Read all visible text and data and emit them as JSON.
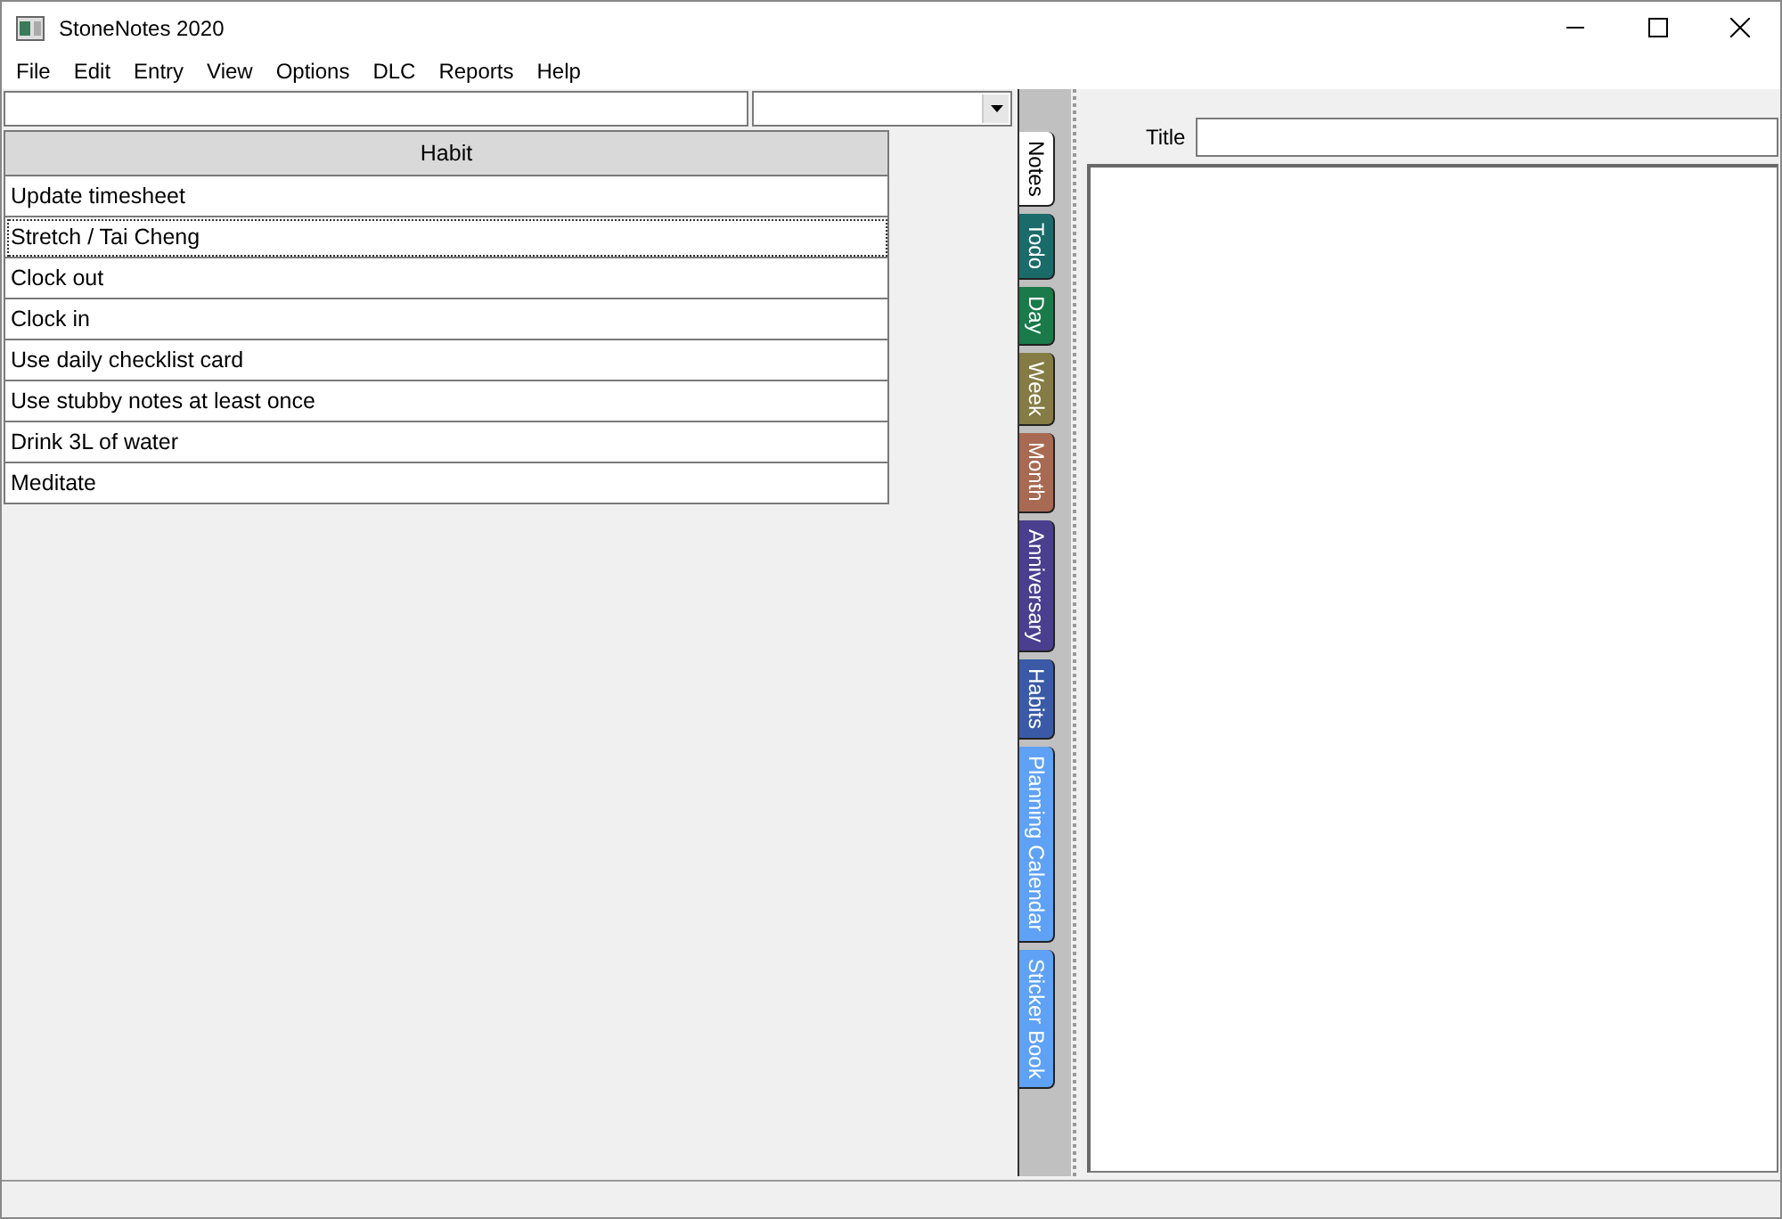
{
  "window": {
    "title": "StoneNotes 2020"
  },
  "menu": [
    "File",
    "Edit",
    "Entry",
    "View",
    "Options",
    "DLC",
    "Reports",
    "Help"
  ],
  "table": {
    "columns": [
      "Habit"
    ],
    "rows": [
      {
        "cells": [
          "Update timesheet"
        ],
        "selected": false
      },
      {
        "cells": [
          "Stretch / Tai Cheng"
        ],
        "selected": true
      },
      {
        "cells": [
          "Clock out"
        ],
        "selected": false
      },
      {
        "cells": [
          "Clock in"
        ],
        "selected": false
      },
      {
        "cells": [
          "Use daily checklist card"
        ],
        "selected": false
      },
      {
        "cells": [
          "Use stubby notes at least once"
        ],
        "selected": false
      },
      {
        "cells": [
          "Drink 3L of water"
        ],
        "selected": false
      },
      {
        "cells": [
          "Meditate"
        ],
        "selected": false
      }
    ]
  },
  "tabs": [
    {
      "label": "Notes",
      "selected": true,
      "color": "#ffffff"
    },
    {
      "label": "Todo",
      "selected": false,
      "color": "#1b6b6b"
    },
    {
      "label": "Day",
      "selected": false,
      "color": "#1a7a4a"
    },
    {
      "label": "Week",
      "selected": false,
      "color": "#847c44"
    },
    {
      "label": "Month",
      "selected": false,
      "color": "#a86a52"
    },
    {
      "label": "Anniversary",
      "selected": false,
      "color": "#4a3f8f"
    },
    {
      "label": "Habits",
      "selected": false,
      "color": "#3a5aa8"
    },
    {
      "label": "Planning Calendar",
      "selected": false,
      "color": "#5fa2f5"
    },
    {
      "label": "Sticker Book",
      "selected": false,
      "color": "#5fa2f5"
    }
  ],
  "editor": {
    "title_label": "Title"
  }
}
